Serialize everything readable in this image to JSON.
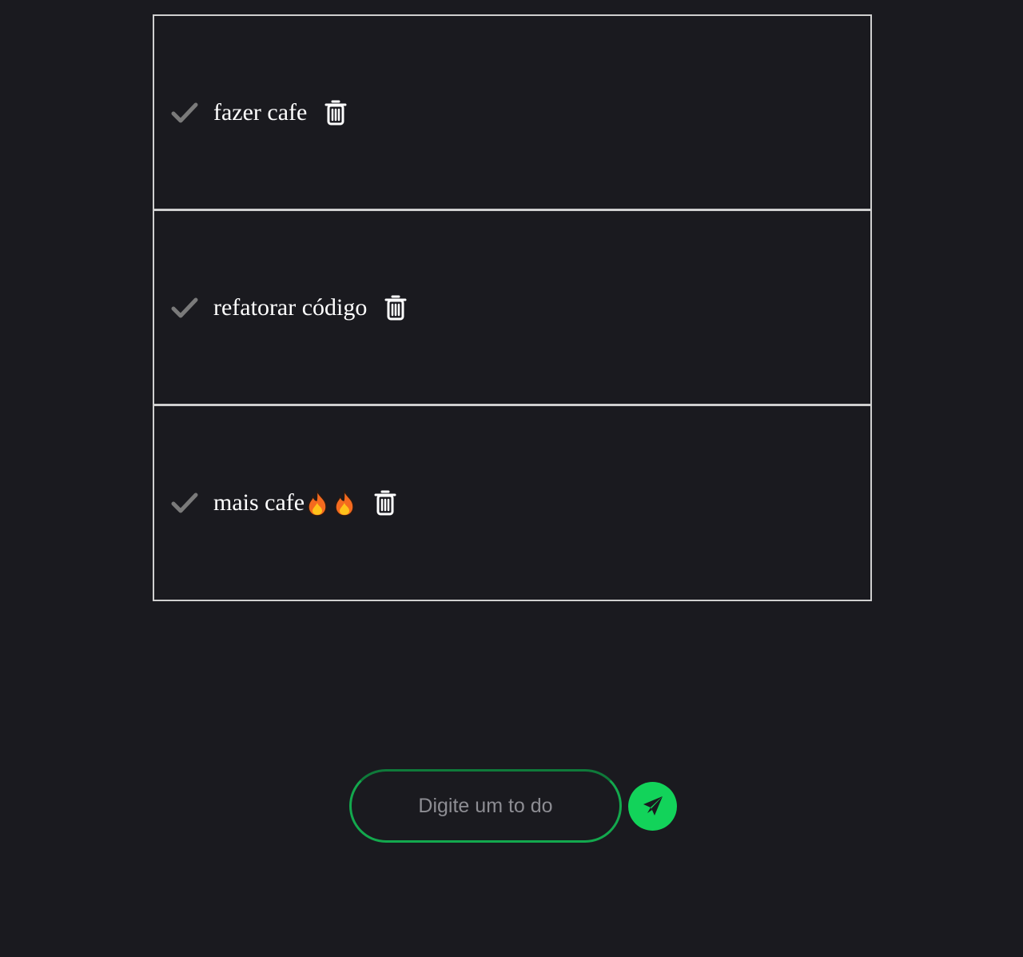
{
  "todos": [
    {
      "text": "fazer cafe",
      "emoji_count": 0,
      "check_icon": "check-icon",
      "delete_icon": "trash-icon"
    },
    {
      "text": "refatorar código",
      "emoji_count": 0,
      "check_icon": "check-icon",
      "delete_icon": "trash-icon"
    },
    {
      "text": "mais cafe",
      "emoji_count": 2,
      "emoji_icon": "fire-emoji-icon",
      "check_icon": "check-icon",
      "delete_icon": "trash-icon"
    }
  ],
  "composer": {
    "placeholder": "Digite um to do",
    "value": "",
    "send_icon": "paper-plane-icon"
  },
  "colors": {
    "background": "#1a1a1f",
    "border": "#cfcfcf",
    "accent": "#12d35a",
    "check": "#7a7a7a"
  }
}
